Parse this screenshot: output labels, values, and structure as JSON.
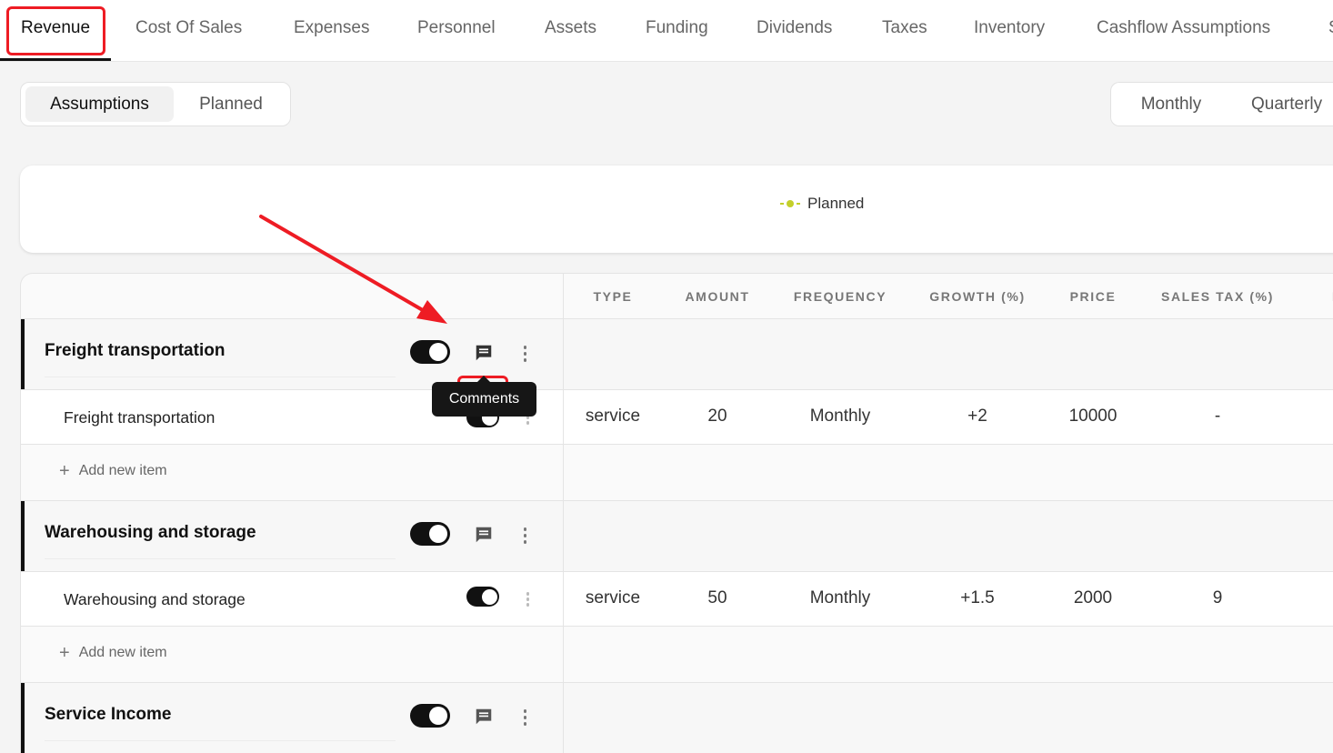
{
  "top_tabs": [
    "Revenue",
    "Cost Of Sales",
    "Expenses",
    "Personnel",
    "Assets",
    "Funding",
    "Dividends",
    "Taxes",
    "Inventory",
    "Cashflow Assumptions",
    "S"
  ],
  "view_toggle": {
    "assumptions": "Assumptions",
    "planned": "Planned"
  },
  "period_toggle": {
    "monthly": "Monthly",
    "quarterly": "Quarterly"
  },
  "legend": {
    "planned": "Planned",
    "color": "#c3cf2a"
  },
  "columns": [
    "TYPE",
    "AMOUNT",
    "FREQUENCY",
    "GROWTH (%)",
    "PRICE",
    "SALES TAX (%)",
    "RE"
  ],
  "groups": [
    {
      "name": "Freight transportation",
      "item": {
        "name": "Freight transportation",
        "type": "service",
        "amount": "20",
        "frequency": "Monthly",
        "growth": "+2",
        "price": "10000",
        "sales_tax": "-"
      },
      "add_label": "Add new item"
    },
    {
      "name": "Warehousing and storage",
      "item": {
        "name": "Warehousing and storage",
        "type": "service",
        "amount": "50",
        "frequency": "Monthly",
        "growth": "+1.5",
        "price": "2000",
        "sales_tax": "9"
      },
      "add_label": "Add new item"
    },
    {
      "name": "Service Income"
    }
  ],
  "tooltip": "Comments",
  "colors": {
    "highlight": "#ee1c24",
    "toggle_on": "#111111"
  }
}
